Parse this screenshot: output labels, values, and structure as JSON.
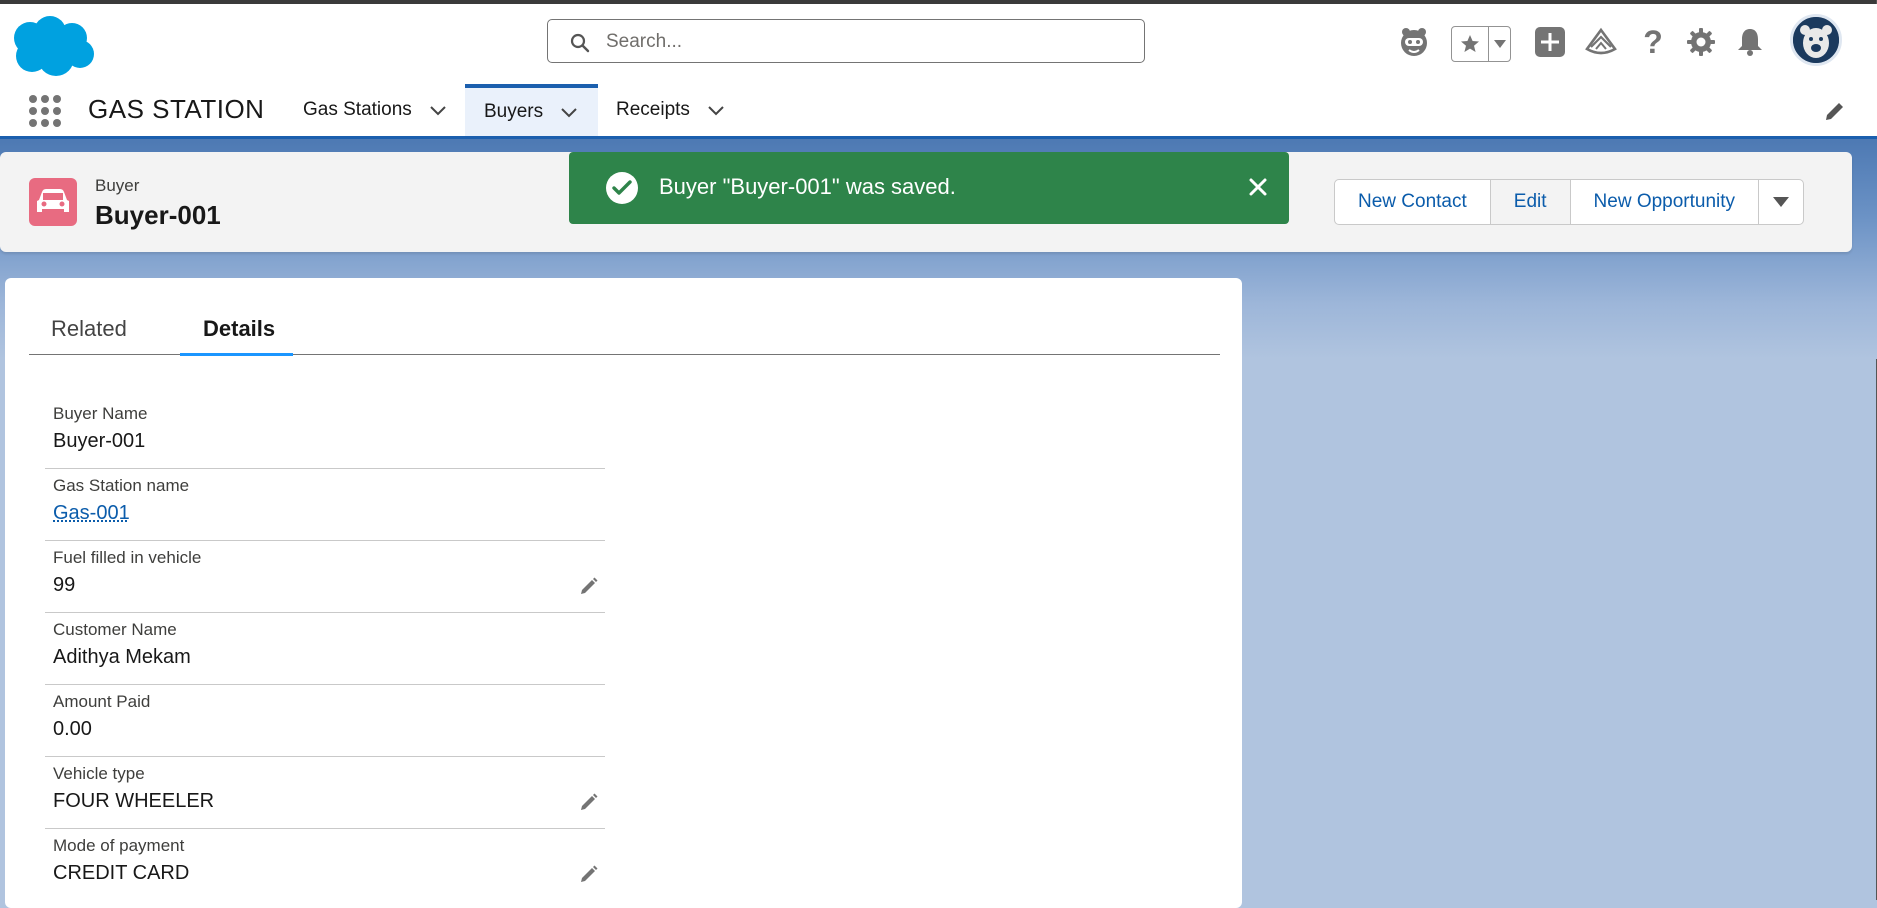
{
  "app": {
    "name": "GAS STATION"
  },
  "search": {
    "placeholder": "Search..."
  },
  "nav": {
    "tabs": [
      {
        "label": "Gas Stations",
        "active": false
      },
      {
        "label": "Buyers",
        "active": true
      },
      {
        "label": "Receipts",
        "active": false
      }
    ]
  },
  "record": {
    "type_label": "Buyer",
    "title": "Buyer-001",
    "icon": "car-icon",
    "icon_color": "#e86b81",
    "actions": [
      "New Contact",
      "Edit",
      "New Opportunity"
    ]
  },
  "toast": {
    "message": "Buyer \"Buyer-001\" was saved.",
    "color": "#2e844a"
  },
  "detail_tabs": [
    "Related",
    "Details"
  ],
  "fields": [
    {
      "label": "Buyer Name",
      "value": "Buyer-001",
      "link": false,
      "editable": false
    },
    {
      "label": "Gas Station name",
      "value": "Gas-001",
      "link": true,
      "editable": false
    },
    {
      "label": "Fuel filled in vehicle",
      "value": "99",
      "link": false,
      "editable": true
    },
    {
      "label": "Customer Name",
      "value": "Adithya Mekam",
      "link": false,
      "editable": false
    },
    {
      "label": "Amount Paid",
      "value": "0.00",
      "link": false,
      "editable": false
    },
    {
      "label": "Vehicle type",
      "value": "FOUR WHEELER",
      "link": false,
      "editable": true
    },
    {
      "label": "Mode of payment",
      "value": "CREDIT CARD",
      "link": false,
      "editable": true
    }
  ],
  "colors": {
    "brand": "#0b5cab",
    "nav_accent": "#1b5fae",
    "tab_underline": "#1b96ff"
  }
}
